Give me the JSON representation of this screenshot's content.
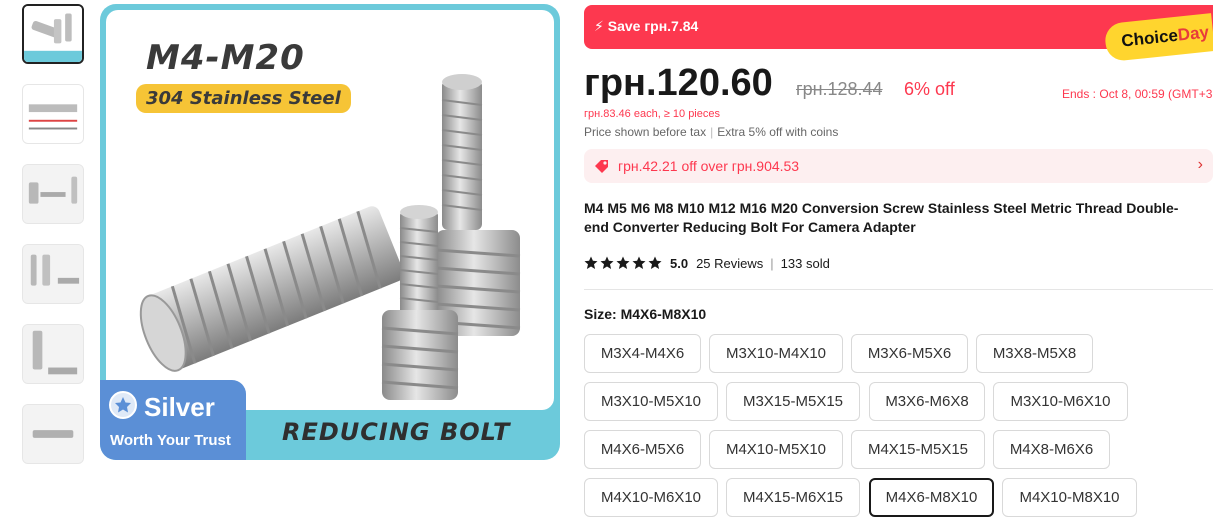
{
  "gallery": {
    "thumbnails": [
      "thumb-1",
      "thumb-2",
      "thumb-3",
      "thumb-4",
      "thumb-5",
      "thumb-6"
    ],
    "main": {
      "heading": "M4-M20",
      "material": "304 Stainless Steel",
      "badge_title": "Silver",
      "badge_sub": "Worth Your Trust",
      "footer": "REDUCING BOLT",
      "accent": "#6ccadb"
    }
  },
  "promo": {
    "save_text": "Save грн.7.84",
    "choice_prefix": "Choice",
    "choice_suffix": "Day",
    "bar_color": "#fd384f"
  },
  "price": {
    "current": "грн.120.60",
    "original": "грн.128.44",
    "discount": "6% off",
    "ends": "Ends :  Oct 8, 00:59 (GMT+3",
    "bulk": "грн.83.46 each, ≥ 10 pieces",
    "tax_note": "Price shown before tax",
    "coins_note": "Extra 5% off with coins"
  },
  "coupon": {
    "text": "грн.42.21 off over грн.904.53",
    "arrow": "›"
  },
  "product": {
    "title": "M4 M5 M6 M8 M10 M12 M16 M20 Conversion Screw Stainless Steel Metric Thread Double-end Converter Reducing Bolt For Camera Adapter",
    "rating_score": "5.0",
    "reviews": "25 Reviews",
    "sold": "133 sold",
    "star_count": 5
  },
  "size": {
    "label": "Size: M4X6-M8X10",
    "options": [
      "M3X4-M4X6",
      "M3X10-M4X10",
      "M3X6-M5X6",
      "M3X8-M5X8",
      "M3X10-M5X10",
      "M3X15-M5X15",
      "M3X6-M6X8",
      "M3X10-M6X10",
      "M4X6-M5X6",
      "M4X10-M5X10",
      "M4X15-M5X15",
      "M4X8-M6X6",
      "M4X10-M6X10",
      "M4X15-M6X15",
      "M4X6-M8X10",
      "M4X10-M8X10"
    ],
    "selected": "M4X6-M8X10"
  }
}
